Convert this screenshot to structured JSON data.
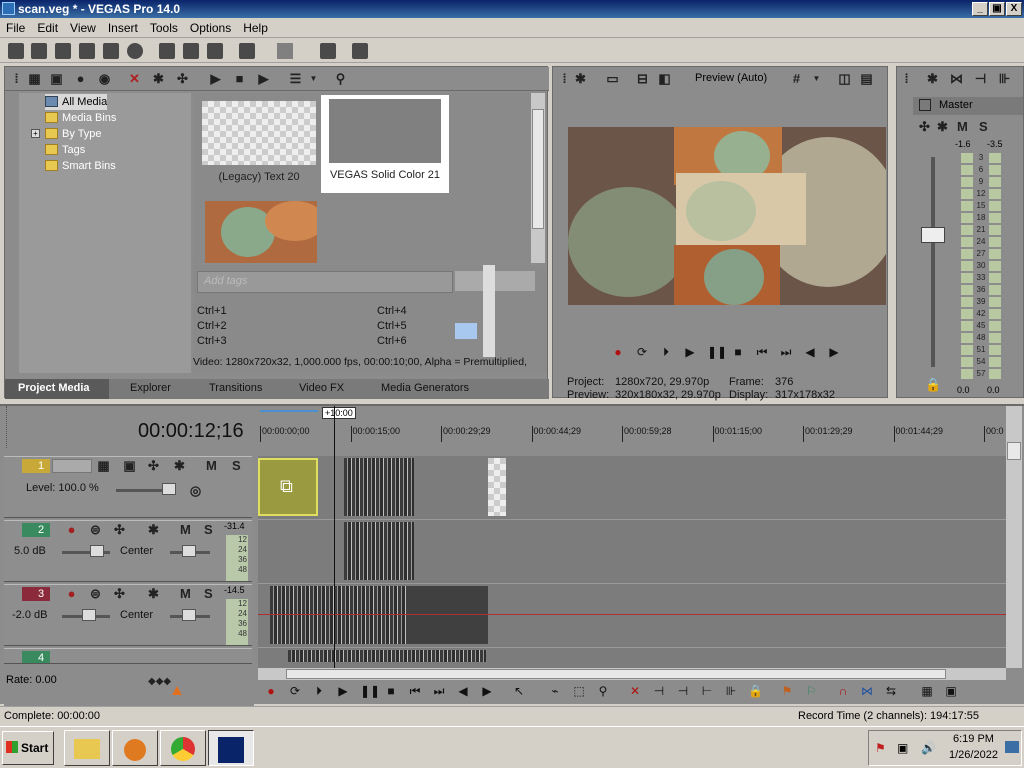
{
  "window": {
    "title": "scan.veg * - VEGAS Pro 14.0",
    "controls": [
      "_",
      "▣",
      "X"
    ]
  },
  "menu": [
    "File",
    "Edit",
    "View",
    "Insert",
    "Tools",
    "Options",
    "Help"
  ],
  "project_media": {
    "tree": [
      "All Media",
      "Media Bins",
      "By Type",
      "Tags",
      "Smart Bins"
    ],
    "thumbs": [
      {
        "label": "(Legacy) Text 20"
      },
      {
        "label": "VEGAS Solid Color 21"
      }
    ],
    "tag_placeholder": "Add tags",
    "shortcuts": [
      "Ctrl+1",
      "Ctrl+2",
      "Ctrl+3",
      "Ctrl+4",
      "Ctrl+5",
      "Ctrl+6"
    ],
    "info": "Video: 1280x720x32, 1,000.000 fps, 00:00:10;00, Alpha = Premultiplied,",
    "tabs": [
      "Project Media",
      "Explorer",
      "Transitions",
      "Video FX",
      "Media Generators"
    ]
  },
  "preview": {
    "mode": "Preview (Auto)",
    "project_label": "Project:",
    "project_value": "1280x720, 29.970p",
    "preview_label": "Preview:",
    "preview_value": "320x180x32, 29.970p",
    "frame_label": "Frame:",
    "frame_value": "376",
    "display_label": "Display:",
    "display_value": "317x178x32"
  },
  "master": {
    "label": "Master",
    "m": "M",
    "s": "S",
    "left_db": "-1.6",
    "right_db": "-3.5",
    "scale": [
      "3",
      "6",
      "9",
      "12",
      "15",
      "18",
      "21",
      "24",
      "27",
      "30",
      "33",
      "36",
      "39",
      "42",
      "45",
      "48",
      "51",
      "54",
      "57"
    ],
    "bottom_left": "0.0",
    "bottom_right": "0.0"
  },
  "timeline": {
    "timecode": "00:00:12;16",
    "loop_label": "+10:00",
    "ruler": [
      "00:00:00;00",
      "00:00:15;00",
      "00:00:29;29",
      "00:00:44;29",
      "00:00:59;28",
      "00:01:15;00",
      "00:01:29;29",
      "00:01:44;29",
      "00:0"
    ],
    "tracks": [
      {
        "num": "1",
        "level_label": "Level: 100.0 %"
      },
      {
        "num": "2",
        "vol": "5.0 dB",
        "pan": "Center",
        "peak": "-31.4"
      },
      {
        "num": "3",
        "vol": "-2.0 dB",
        "pan": "Center",
        "peak": "-14.5"
      },
      {
        "num": "4"
      }
    ],
    "meter_scale": [
      "12",
      "24",
      "36",
      "48"
    ],
    "rate": "Rate: 0.00"
  },
  "status": {
    "left": "Complete: 00:00:00",
    "right": "Record Time (2 channels): 194:17:55"
  },
  "taskbar": {
    "start": "Start",
    "time": "6:19 PM",
    "date": "1/26/2022"
  },
  "colors": {
    "track1": "#c8a838",
    "track2": "#3a8a60",
    "track3": "#8a2a3a",
    "track4": "#3a8a60"
  }
}
